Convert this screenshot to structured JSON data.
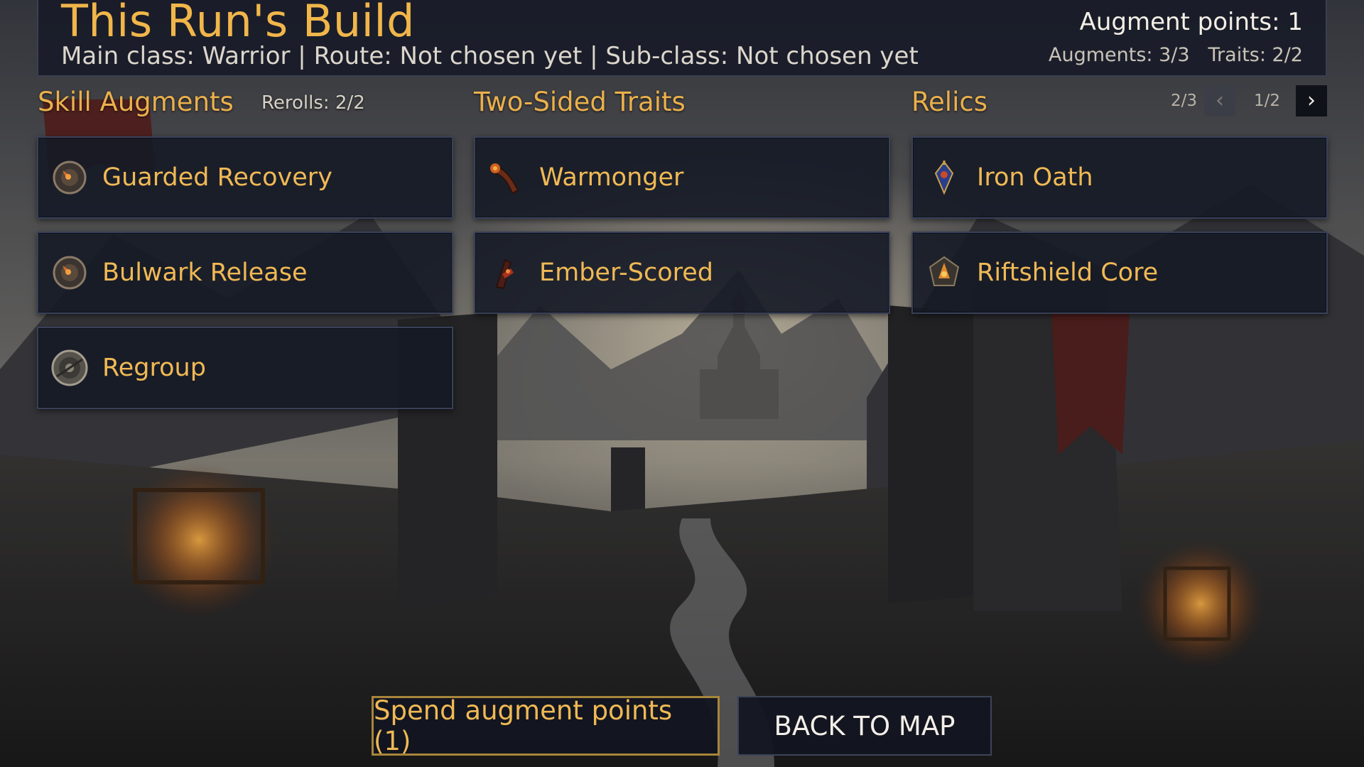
{
  "header": {
    "title": "This Run's Build",
    "subtitle": "Main class: Warrior | Route: Not chosen yet | Sub-class: Not chosen yet",
    "augment_points": "Augment points: 1",
    "augments": "Augments: 3/3",
    "traits": "Traits: 2/2"
  },
  "columns": {
    "skill_augments": {
      "title": "Skill Augments",
      "rerolls": "Rerolls: 2/2",
      "items": [
        {
          "label": "Guarded Recovery",
          "icon": "shield-spark-icon"
        },
        {
          "label": "Bulwark Release",
          "icon": "shield-spark-icon"
        },
        {
          "label": "Regroup",
          "icon": "round-shield-icon"
        }
      ]
    },
    "traits": {
      "title": "Two-Sided Traits",
      "items": [
        {
          "label": "Warmonger",
          "icon": "war-horn-icon"
        },
        {
          "label": "Ember-Scored",
          "icon": "ember-claw-icon"
        }
      ]
    },
    "relics": {
      "title": "Relics",
      "page_count_a": "2/3",
      "prev": "‹",
      "page_count_b": "1/2",
      "next": "›",
      "items": [
        {
          "label": "Iron Oath",
          "icon": "oath-amulet-icon"
        },
        {
          "label": "Riftshield Core",
          "icon": "rift-core-icon"
        }
      ]
    }
  },
  "footer": {
    "spend": "Spend augment points (1)",
    "back": "BACK TO MAP"
  },
  "colors": {
    "accent": "#f0b955",
    "panel": "#151926",
    "border": "#39415a",
    "spend_border": "#a8853a"
  }
}
